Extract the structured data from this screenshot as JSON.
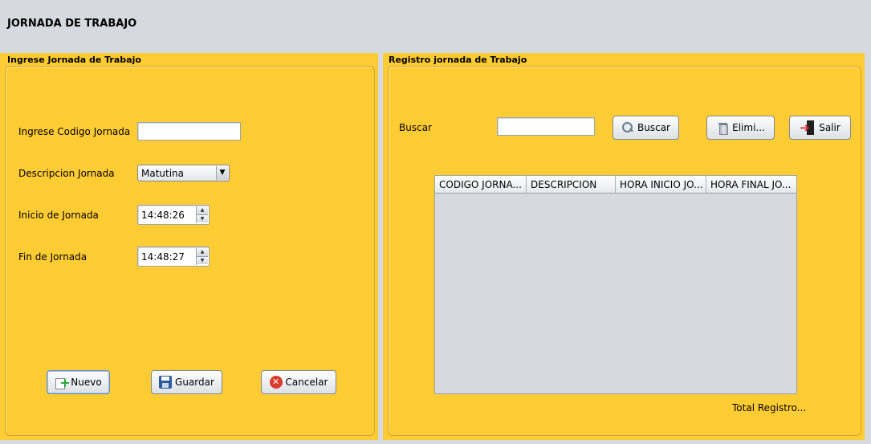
{
  "window": {
    "title": "JORNADA DE TRABAJO"
  },
  "left_panel": {
    "title": "Ingrese Jornada de Trabajo",
    "fields": {
      "codigo_label": "Ingrese Codigo Jornada",
      "codigo_value": "",
      "descripcion_label": "Descripcion Jornada",
      "descripcion_value": "Matutina",
      "inicio_label": "Inicio de Jornada",
      "inicio_value": "14:48:26",
      "fin_label": "Fin de Jornada",
      "fin_value": "14:48:27"
    },
    "buttons": {
      "nuevo": "Nuevo",
      "guardar": "Guardar",
      "cancelar": "Cancelar"
    }
  },
  "right_panel": {
    "title": "Registro jornada de Trabajo",
    "search_label": "Buscar",
    "search_value": "",
    "buttons": {
      "buscar": "Buscar",
      "eliminar": "Elimi...",
      "salir": "Salir"
    },
    "table": {
      "columns": [
        "CODIGO JORNA...",
        "DESCRIPCION",
        "HORA INICIO JO...",
        "HORA FINAL JO..."
      ],
      "rows": []
    },
    "total_label": "Total Registro..."
  },
  "icons": {
    "nuevo": "add-document-icon",
    "guardar": "floppy-save-icon",
    "cancelar": "cancel-icon",
    "buscar": "magnifier-icon",
    "eliminar": "trash-icon",
    "salir": "exit-door-icon"
  },
  "colors": {
    "panel_bg": "#ffcc33",
    "window_bg": "#d6d9df"
  }
}
